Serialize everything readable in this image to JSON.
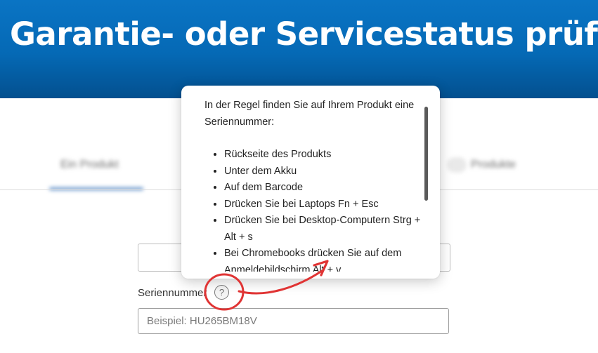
{
  "banner": {
    "title": "Garantie- oder Servicestatus prüfen"
  },
  "background": {
    "tab_left": "Ein Produkt",
    "tab_right": "Produkte",
    "ghost_label": "",
    "ghost_input_text": ""
  },
  "serial": {
    "label": "Seriennummer",
    "help_symbol": "?",
    "placeholder": "Beispiel: HU265BM18V",
    "value": ""
  },
  "tooltip": {
    "intro": "In der Regel finden Sie auf Ihrem Produkt eine Seriennummer:",
    "items": [
      "Rückseite des Produkts",
      "Unter dem Akku",
      "Auf dem Barcode",
      "Drücken Sie bei Laptops Fn + Esc",
      "Drücken Sie bei Desktop-Computern Strg + Alt + s",
      "Bei Chromebooks drücken Sie auf dem Anmeldebildschirm Alt + v"
    ]
  },
  "colors": {
    "banner": "#0569b5",
    "annotation": "#e03434",
    "tab_underline": "#5f8ec7"
  },
  "icons": {
    "help": "question-circle-icon",
    "annotation_arrow": "curved-arrow-icon"
  }
}
